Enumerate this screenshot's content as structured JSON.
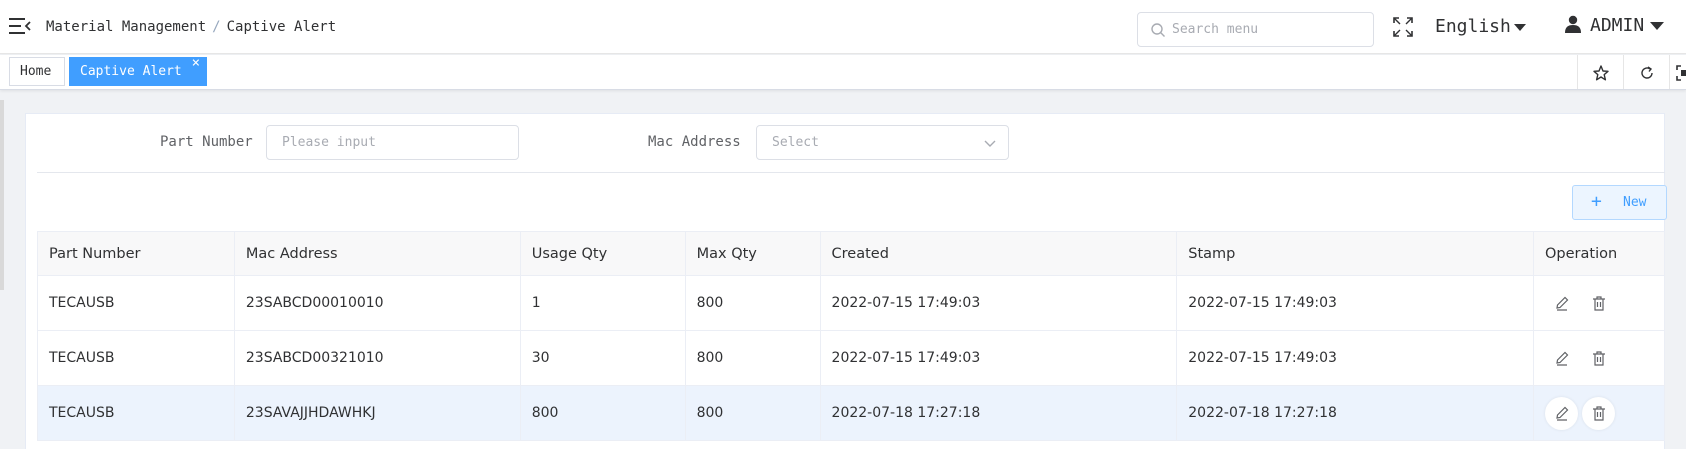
{
  "header": {
    "breadcrumb": [
      "Material Management",
      "Captive Alert"
    ],
    "breadcrumb_sep": "/",
    "search_placeholder": "Search menu",
    "language": "English",
    "user": "ADMIN"
  },
  "tags": {
    "home": "Home",
    "active": "Captive Alert",
    "close_glyph": "×"
  },
  "filters": {
    "part_number_label": "Part Number",
    "part_number_placeholder": "Please input",
    "mac_address_label": "Mac Address",
    "mac_address_placeholder": "Select"
  },
  "toolbar": {
    "new_label": "New",
    "plus_glyph": "+"
  },
  "table": {
    "columns": [
      "Part Number",
      "Mac Address",
      "Usage Qty",
      "Max Qty",
      "Created",
      "Stamp",
      "Operation"
    ],
    "rows": [
      [
        "TECAUSB",
        "23SABCD00010010",
        "1",
        "800",
        "2022-07-15 17:49:03",
        "2022-07-15 17:49:03"
      ],
      [
        "TECAUSB",
        "23SABCD00321010",
        "30",
        "800",
        "2022-07-15 17:49:03",
        "2022-07-15 17:49:03"
      ],
      [
        "TECAUSB",
        "23SAVAJJHDAWHKJ",
        "800",
        "800",
        "2022-07-18 17:27:18",
        "2022-07-18 17:27:18"
      ]
    ]
  },
  "icons": {
    "menu": "menu-fold-icon",
    "search": "search-icon",
    "fullscreen": "fullscreen-icon",
    "user": "user-icon",
    "star": "star-icon",
    "refresh": "refresh-icon",
    "expand": "expand-icon",
    "edit": "edit-icon",
    "delete": "delete-icon"
  },
  "colors": {
    "accent": "#409eff",
    "highlight_row": "#ecf3fd"
  }
}
